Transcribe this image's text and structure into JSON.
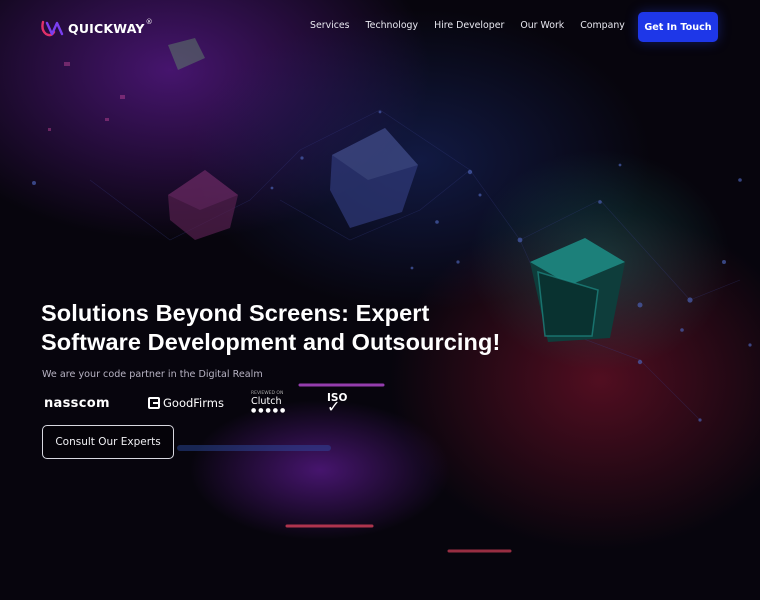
{
  "header": {
    "logo_text": "QUICKWAY",
    "logo_reg": "®",
    "nav": [
      {
        "label": "Services"
      },
      {
        "label": "Technology"
      },
      {
        "label": "Hire Developer"
      },
      {
        "label": "Our Work"
      },
      {
        "label": "Company"
      }
    ],
    "cta_label": "Get In Touch"
  },
  "hero": {
    "title_line1": "Solutions Beyond Screens: Expert",
    "title_line2": "Software Development and Outsourcing!",
    "subtitle": "We are your code partner in the Digital Realm",
    "badges": {
      "nasscom": "nasscom",
      "goodfirms": "GoodFirms",
      "clutch_small": "REVIEWED ON",
      "clutch": "Clutch",
      "clutch_stars": "●●●●●",
      "iso": "ISO"
    },
    "cta_label": "Consult Our Experts"
  },
  "colors": {
    "background": "#07050d",
    "accent_blue": "#1e37e8",
    "glow_purple": "#6b1fa8",
    "glow_red": "#c81e3c",
    "cube_teal": "#1f8c86"
  }
}
